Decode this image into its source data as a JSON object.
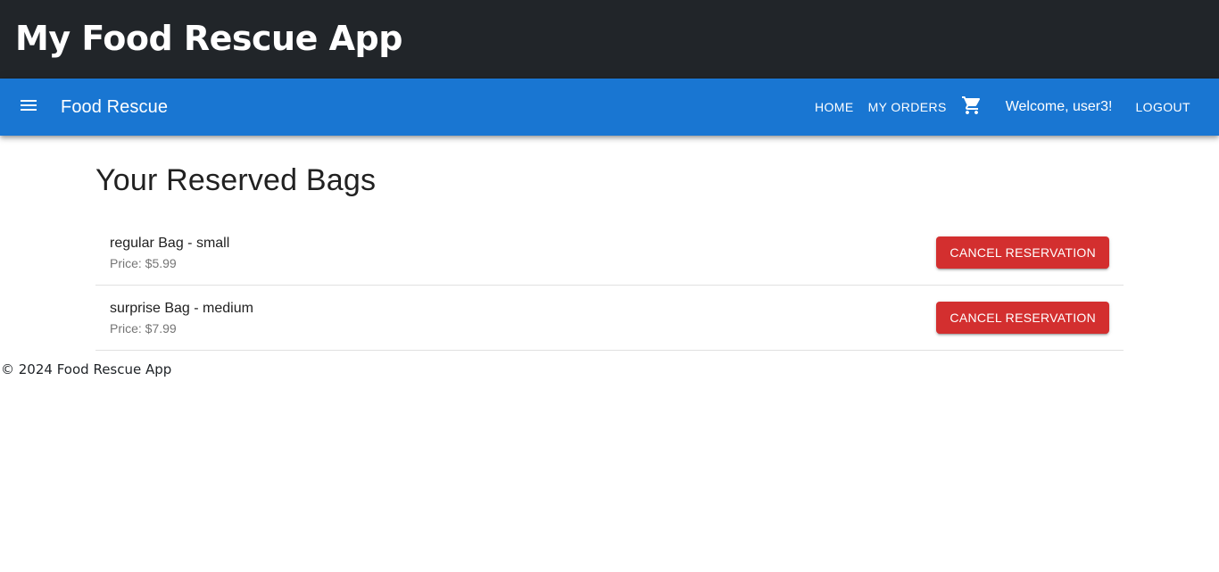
{
  "header": {
    "title": "My Food Rescue App"
  },
  "navbar": {
    "brand": "Food Rescue",
    "menu_icon": "menu-icon",
    "links": {
      "home": "HOME",
      "my_orders": "MY ORDERS",
      "logout": "LOGOUT"
    },
    "cart_icon": "cart-icon",
    "welcome": "Welcome, user3!",
    "accent_color": "#1976d2"
  },
  "main": {
    "title": "Your Reserved Bags",
    "bags": [
      {
        "name": "regular Bag - small",
        "price": "Price: $5.99",
        "action": "CANCEL RESERVATION"
      },
      {
        "name": "surprise Bag - medium",
        "price": "Price: $7.99",
        "action": "CANCEL RESERVATION"
      }
    ],
    "action_color": "#d32f2f"
  },
  "footer": {
    "text": "© 2024 Food Rescue App"
  }
}
